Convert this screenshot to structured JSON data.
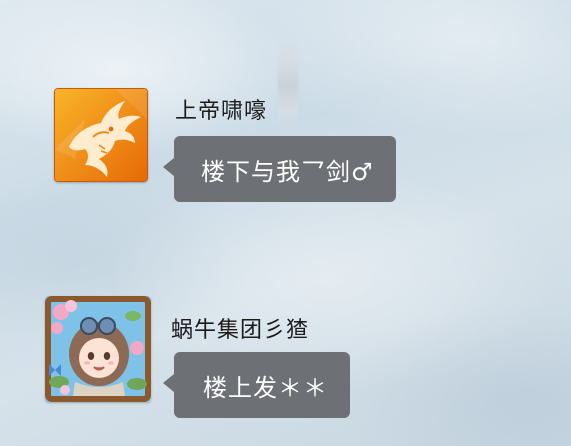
{
  "messages": [
    {
      "sender": "上帝啸嚎",
      "text": "楼下与我乛剑♂",
      "avatar_icon": "dragon-avatar-icon",
      "avatar_colors": {
        "bg_top": "#f7a21a",
        "bg_bottom": "#e9740c",
        "figure": "#fff3df"
      }
    },
    {
      "sender": "蜗牛集团彡猹",
      "text": "楼上发＊＊",
      "avatar_icon": "anime-girl-avatar-icon",
      "avatar_colors": {
        "frame": "#8a5a2e",
        "flowers": "#f3a9c6",
        "leaves": "#6fa85a",
        "sky": "#7fc2e8"
      }
    }
  ],
  "colors": {
    "bubble": "#6d7074",
    "bubble_text": "#ffffff",
    "sender_text": "#1c1c1c"
  }
}
